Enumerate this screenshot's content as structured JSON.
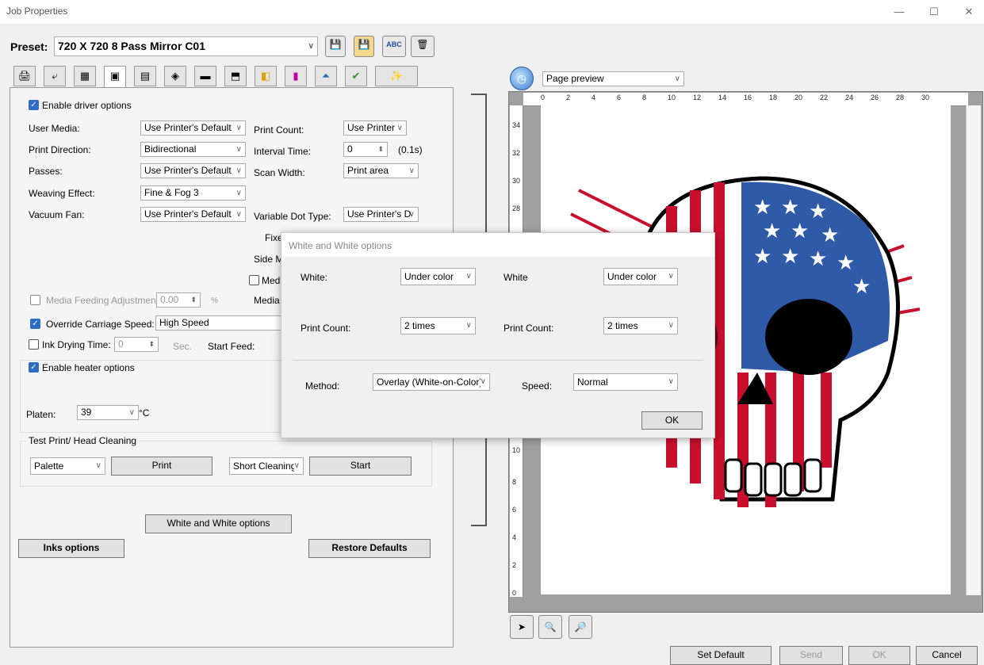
{
  "window": {
    "title": "Job Properties",
    "minimize": "—",
    "maximize": "☐",
    "close": "✕"
  },
  "preset": {
    "label": "Preset:",
    "value": "720 X 720 8 Pass Mirror C01",
    "btn_glyphs": [
      "💾",
      "💾",
      "ABC",
      "🗑"
    ]
  },
  "tabs": {
    "glyphs": [
      "🖨",
      "⤶",
      "▦",
      "▣",
      "▤",
      "◈",
      "▬",
      "⬒",
      "◧",
      "▮",
      "⏶",
      "✔",
      "✨"
    ]
  },
  "driver": {
    "enable_label": "Enable driver options",
    "user_media": {
      "label": "User Media:",
      "value": "Use Printer's Default"
    },
    "print_direction": {
      "label": "Print Direction:",
      "value": "Bidirectional"
    },
    "passes": {
      "label": "Passes:",
      "value": "Use Printer's Default"
    },
    "weaving": {
      "label": "Weaving Effect:",
      "value": "Fine & Fog 3"
    },
    "vacuum": {
      "label": "Vacuum Fan:",
      "value": "Use Printer's Default"
    },
    "print_count": {
      "label": "Print Count:",
      "value": "Use Printer"
    },
    "interval": {
      "label": "Interval Time:",
      "value": "0",
      "unit": "(0.1s)"
    },
    "scan_width": {
      "label": "Scan Width:",
      "value": "Print area"
    },
    "variable_dot": {
      "label": "Variable Dot Type:",
      "value": "Use Printer's D"
    },
    "fixed_partial": "Fixed D",
    "side_partial": "Side M",
    "medi_partial": "Medi",
    "media_partial": "Media",
    "media_feeding": {
      "label": "Media Feeding Adjustment:",
      "value": "0.00",
      "unit": "%"
    },
    "override_speed": {
      "label": "Override Carriage Speed:",
      "value": "High Speed"
    },
    "ink_drying": {
      "label": "Ink Drying Time:",
      "value": "0",
      "unit": "Sec.",
      "start_feed": "Start Feed:"
    }
  },
  "heater": {
    "enable_label": "Enable heater options",
    "platen_label": "Platen:",
    "platen_value": "39",
    "unit": "°C"
  },
  "test": {
    "group_label": "Test Print/ Head Cleaning",
    "palette": "Palette",
    "print_btn": "Print",
    "cleaning": "Short Cleaning",
    "start_btn": "Start"
  },
  "buttons": {
    "white_options": "White and White options",
    "inks_options": "Inks options",
    "restore": "Restore Defaults"
  },
  "preview": {
    "mode": "Page preview",
    "h_ticks": [
      "0",
      "2",
      "4",
      "6",
      "8",
      "10",
      "12",
      "14",
      "16",
      "18",
      "20",
      "22",
      "24",
      "26",
      "28",
      "30"
    ],
    "v_ticks": [
      "34",
      "32",
      "30",
      "28",
      "10",
      "8",
      "6",
      "4",
      "2",
      "0"
    ]
  },
  "bottom": {
    "set_default": "Set Default",
    "send": "Send",
    "ok": "OK",
    "cancel": "Cancel"
  },
  "dialog": {
    "title": "White and White options",
    "white_label": "White:",
    "white_value": "Under color",
    "white2_label": "White",
    "white2_value": "Under color",
    "count_label": "Print Count:",
    "count_value": "2 times",
    "count2_label": "Print Count:",
    "count2_value": "2 times",
    "method_label": "Method:",
    "method_value": "Overlay (White-on-Color)",
    "speed_label": "Speed:",
    "speed_value": "Normal",
    "ok": "OK"
  },
  "colors": {
    "accent": "#2f6cc5",
    "flag_red": "#c8102e",
    "flag_blue": "#2e5aa8"
  }
}
